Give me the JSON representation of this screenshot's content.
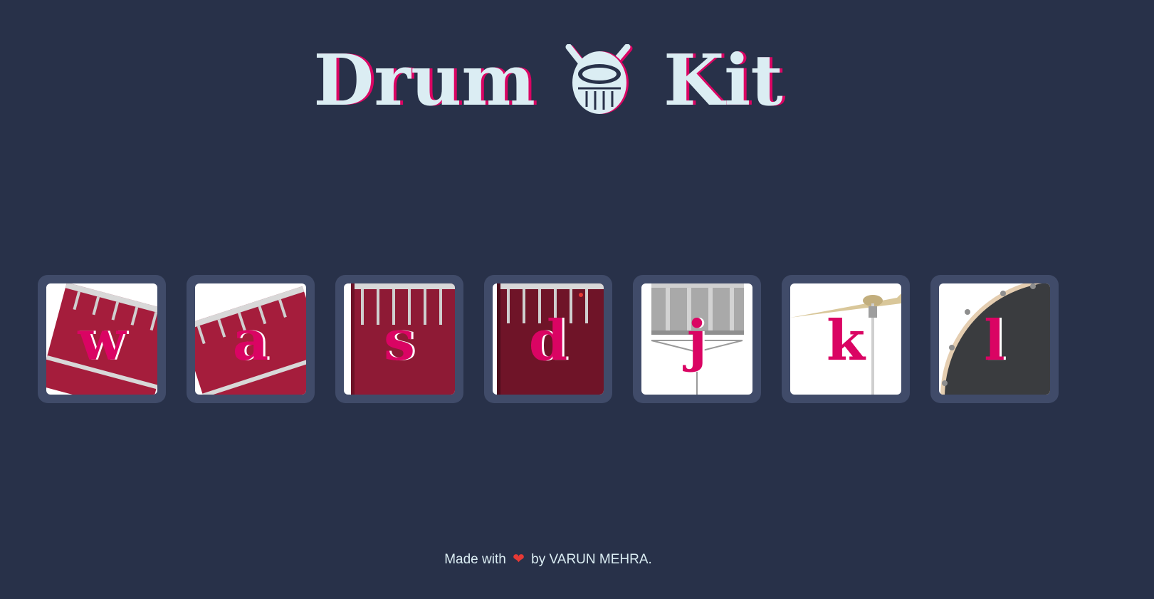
{
  "header": {
    "title_left": "Drum",
    "title_right": "Kit",
    "logo_icon": "drum-icon"
  },
  "drums": [
    {
      "key": "w",
      "image": "tom-1"
    },
    {
      "key": "a",
      "image": "tom-2"
    },
    {
      "key": "s",
      "image": "tom-3"
    },
    {
      "key": "d",
      "image": "tom-4"
    },
    {
      "key": "j",
      "image": "snare"
    },
    {
      "key": "k",
      "image": "crash"
    },
    {
      "key": "l",
      "image": "kick-bass"
    }
  ],
  "footer": {
    "prefix": "Made with",
    "heart_icon": "heart-icon",
    "suffix": "by VARUN MEHRA."
  },
  "colors": {
    "background": "#283149",
    "button": "#404B69",
    "accent": "#DA0463",
    "text": "#DBEDF3"
  }
}
